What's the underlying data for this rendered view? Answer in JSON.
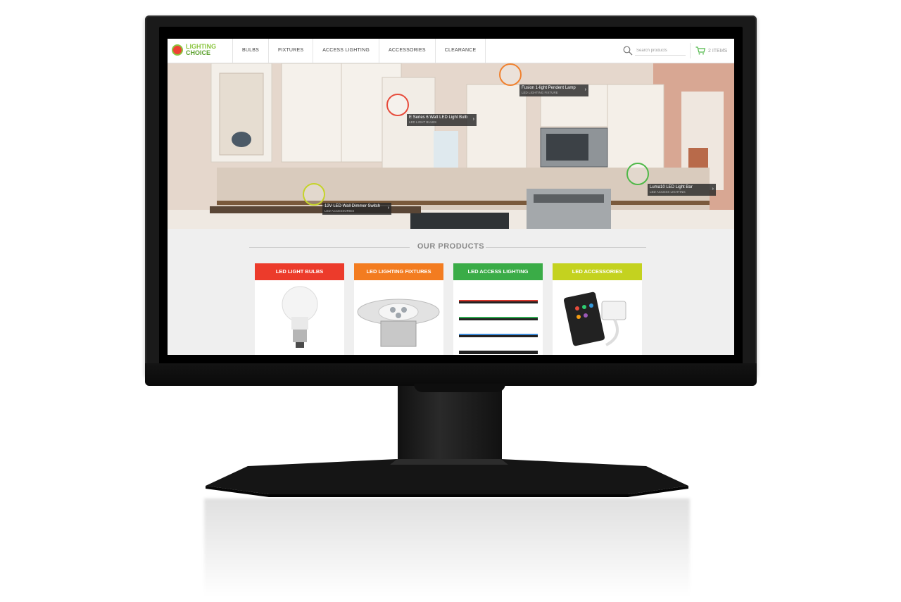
{
  "site": {
    "logo": {
      "line1": "LIGHTING",
      "line2": "CHOICE"
    },
    "nav": [
      "BULBS",
      "FIXTURES",
      "ACCESS LIGHTING",
      "ACCESSORIES",
      "CLEARANCE"
    ],
    "search": {
      "placeholder": "Search products"
    },
    "cart": {
      "label": "2 ITEMS"
    }
  },
  "hero": {
    "hotspots": [
      {
        "name": "E Series 6 Watt LED Light Bulb",
        "category": "LED LIGHT BULBS",
        "color": "#e74c3c"
      },
      {
        "name": "Fusion 1-light Pendent Lamp",
        "category": "LED LIGHTING FIXTURE",
        "color": "#f0812e"
      },
      {
        "name": "12V LED Wall Dimmer Switch",
        "category": "LED ACCESSORIES",
        "color": "#c5d32a"
      },
      {
        "name": "Luma10 LED Light Bar",
        "category": "LED ACCESS LIGHTING",
        "color": "#4fb848"
      }
    ]
  },
  "products": {
    "title": "OUR PRODUCTS",
    "cards": [
      {
        "label": "LED LIGHT BULBS",
        "color": "#ec3b2b"
      },
      {
        "label": "LED LIGHTING FIXTURES",
        "color": "#f37c20"
      },
      {
        "label": "LED ACCESS LIGHTING",
        "color": "#3aac47"
      },
      {
        "label": "LED ACCESSORIES",
        "color": "#c4d21f"
      }
    ]
  }
}
